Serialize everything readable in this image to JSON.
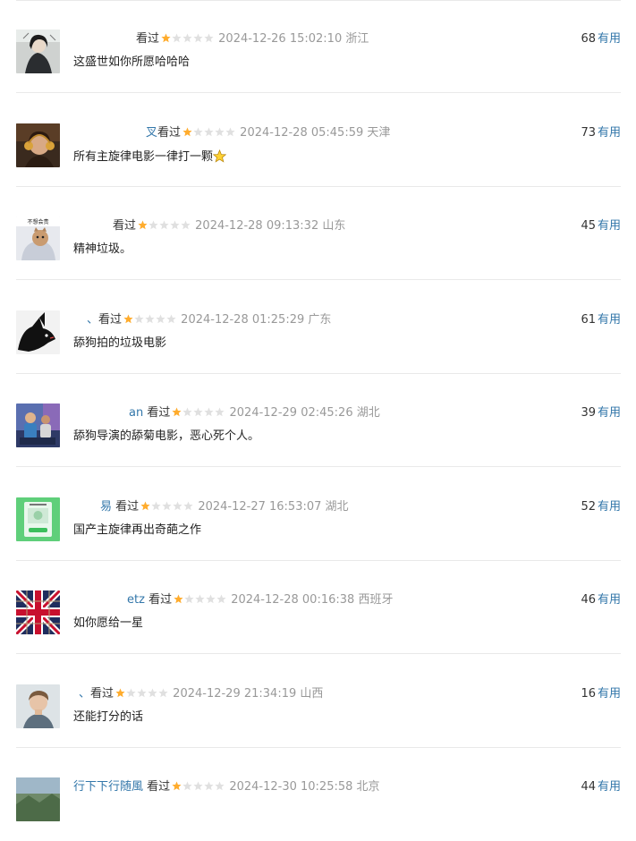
{
  "reviews": [
    {
      "user_fragment": "",
      "seen": "看过",
      "rating": 1,
      "time": "2024-12-26 15:02:10",
      "location": "浙江",
      "votes": "68",
      "useful": "有用",
      "text": "这盛世如你所愿哈哈哈",
      "avatar": "portrait-dark-hair",
      "has_emoji": false
    },
    {
      "user_fragment": "叉",
      "seen": "看过",
      "rating": 1,
      "time": "2024-12-28 05:45:59",
      "location": "天津",
      "votes": "73",
      "useful": "有用",
      "text": "所有主旋律电影一律打一颗",
      "avatar": "person-with-headphones",
      "has_emoji": true
    },
    {
      "user_fragment": "",
      "seen": "看过",
      "rating": 1,
      "time": "2024-12-28 09:13:32",
      "location": "山东",
      "votes": "45",
      "useful": "有用",
      "text": "精神垃圾。",
      "avatar": "cat-meme",
      "has_emoji": false,
      "overlap_char": "看"
    },
    {
      "user_fragment": "、",
      "seen": "看过",
      "rating": 1,
      "time": "2024-12-28 01:25:29",
      "location": "广东",
      "votes": "61",
      "useful": "有用",
      "text": "舔狗拍的垃圾电影",
      "avatar": "black-cat",
      "has_emoji": false
    },
    {
      "user_fragment": "an",
      "seen": "看过",
      "rating": 1,
      "time": "2024-12-29 02:45:26",
      "location": "湖北",
      "votes": "39",
      "useful": "有用",
      "text": "舔狗导演的舔菊电影，恶心死个人。",
      "avatar": "group-photo",
      "has_emoji": false
    },
    {
      "user_fragment": "易",
      "seen": "看过",
      "rating": 1,
      "time": "2024-12-27 16:53:07",
      "location": "湖北",
      "votes": "52",
      "useful": "有用",
      "text": "国产主旋律再出奇葩之作",
      "avatar": "green-card",
      "has_emoji": false
    },
    {
      "user_fragment": "etz",
      "seen": "看过",
      "rating": 1,
      "time": "2024-12-28 00:16:38",
      "location": "西班牙",
      "votes": "46",
      "useful": "有用",
      "text": "如你愿给一星",
      "avatar": "union-jack-pattern",
      "has_emoji": false
    },
    {
      "user_fragment": "、",
      "seen": "看过",
      "rating": 1,
      "time": "2024-12-29 21:34:19",
      "location": "山西",
      "votes": "16",
      "useful": "有用",
      "text": "还能打分的话",
      "avatar": "man-portrait",
      "has_emoji": false
    },
    {
      "user_fragment": "行下下行随風",
      "seen": "看过",
      "rating": 1,
      "time": "2024-12-30 10:25:58",
      "location": "北京",
      "votes": "44",
      "useful": "有用",
      "text": "",
      "avatar": "landscape",
      "has_emoji": false
    }
  ],
  "colors": {
    "link": "#3377aa",
    "star_on": "#ffac2d",
    "star_off": "#e0e0e0",
    "meta": "#999999"
  }
}
